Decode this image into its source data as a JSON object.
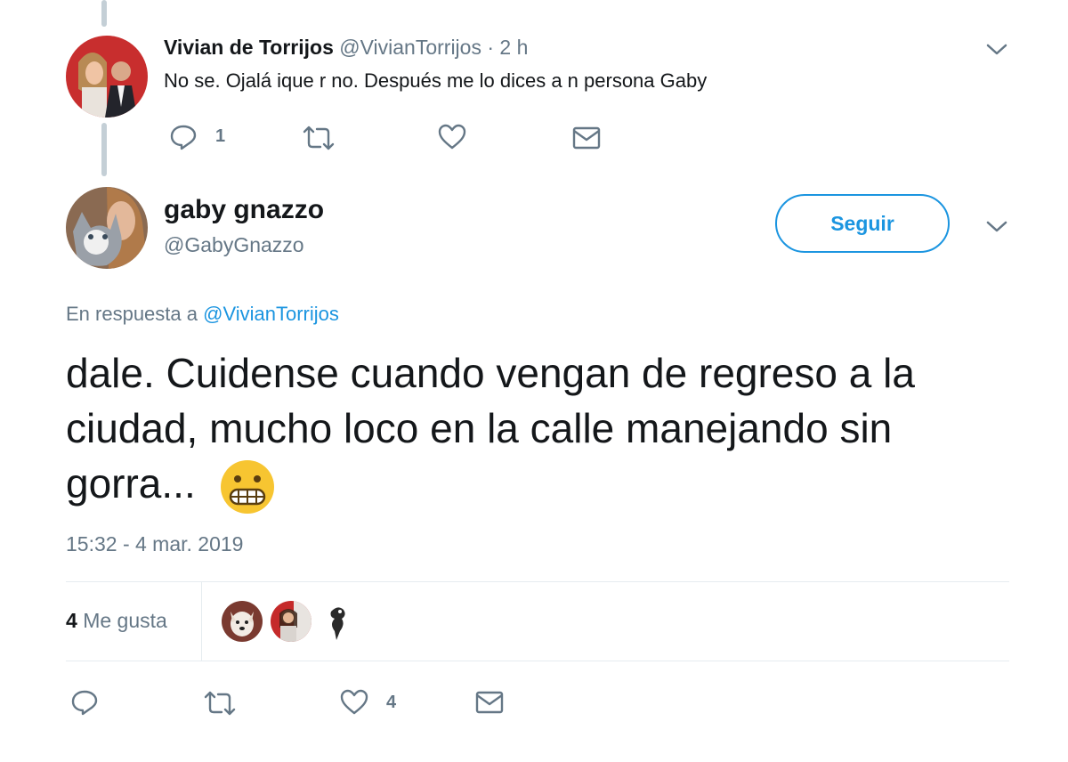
{
  "parent_tweet": {
    "display_name": "Vivian de Torrijos",
    "handle": "@VivianTorrijos",
    "time": "· 2 h",
    "text": "No se. Ojalá ique r no. Después me lo dices a n persona Gaby",
    "actions": {
      "reply_count": "1"
    }
  },
  "main_tweet": {
    "display_name": "gaby gnazzo",
    "handle": "@GabyGnazzo",
    "follow_label": "Seguir",
    "reply_prefix": "En respuesta a",
    "reply_to": "@VivianTorrijos",
    "text": "dale. Cuidense cuando vengan de regreso a la ciudad, mucho loco en la calle manejando sin gorra...",
    "emoji": "😬",
    "timestamp": "15:32 - 4 mar. 2019",
    "likes": {
      "count": "4",
      "label": "Me gusta"
    },
    "actions": {
      "like_count": "4"
    }
  },
  "colors": {
    "accent": "#1b95e0",
    "muted": "#657786",
    "border": "#e6ecf0"
  }
}
